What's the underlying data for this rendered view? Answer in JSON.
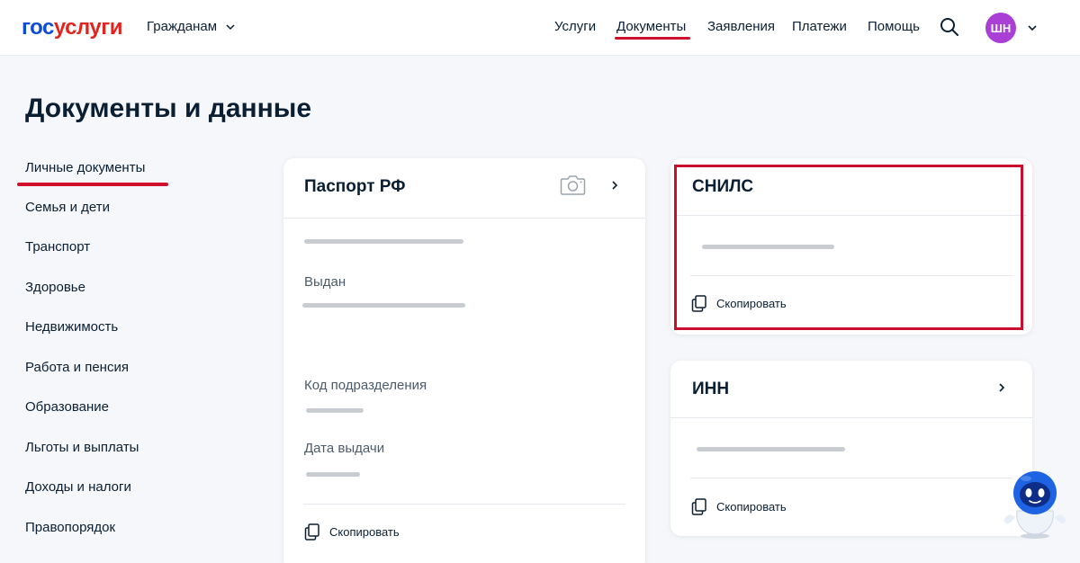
{
  "header": {
    "logo_part1": "гос",
    "logo_part2": "услуги",
    "audience_label": "Гражданам",
    "nav": [
      "Услуги",
      "Документы",
      "Заявления",
      "Платежи",
      "Помощь"
    ],
    "active_nav": "Документы",
    "avatar_initials": "ШН",
    "icons": [
      "chevron-down-icon",
      "search-icon"
    ]
  },
  "page": {
    "title": "Документы и данные"
  },
  "sidebar": {
    "items": [
      {
        "label": "Личные документы"
      },
      {
        "label": "Семья и дети"
      },
      {
        "label": "Транспорт"
      },
      {
        "label": "Здоровье"
      },
      {
        "label": "Недвижимость"
      },
      {
        "label": "Работа и пенсия"
      },
      {
        "label": "Образование"
      },
      {
        "label": "Льготы и выплаты"
      },
      {
        "label": "Доходы и налоги"
      },
      {
        "label": "Правопорядок"
      }
    ],
    "active_item": "Личные документы"
  },
  "passport_card": {
    "title": "Паспорт РФ",
    "field_issued": "Выдан",
    "field_division_code": "Код подразделения",
    "field_issue_date": "Дата выдачи",
    "copy_label": "Скопировать",
    "icons": [
      "camera-icon",
      "chevron-right-icon",
      "copy-icon"
    ]
  },
  "snils_card": {
    "title": "СНИЛС",
    "copy_label": "Скопировать",
    "highlighted": true
  },
  "inn_card": {
    "title": "ИНН",
    "copy_label": "Скопировать"
  },
  "colors": {
    "brand_blue": "#0d4cd3",
    "brand_red": "#e3241e",
    "accent_underline": "#d0102a",
    "highlight_border": "#c8102e",
    "avatar_bg": "#a93fd4",
    "page_bg": "#f5f7fa"
  }
}
